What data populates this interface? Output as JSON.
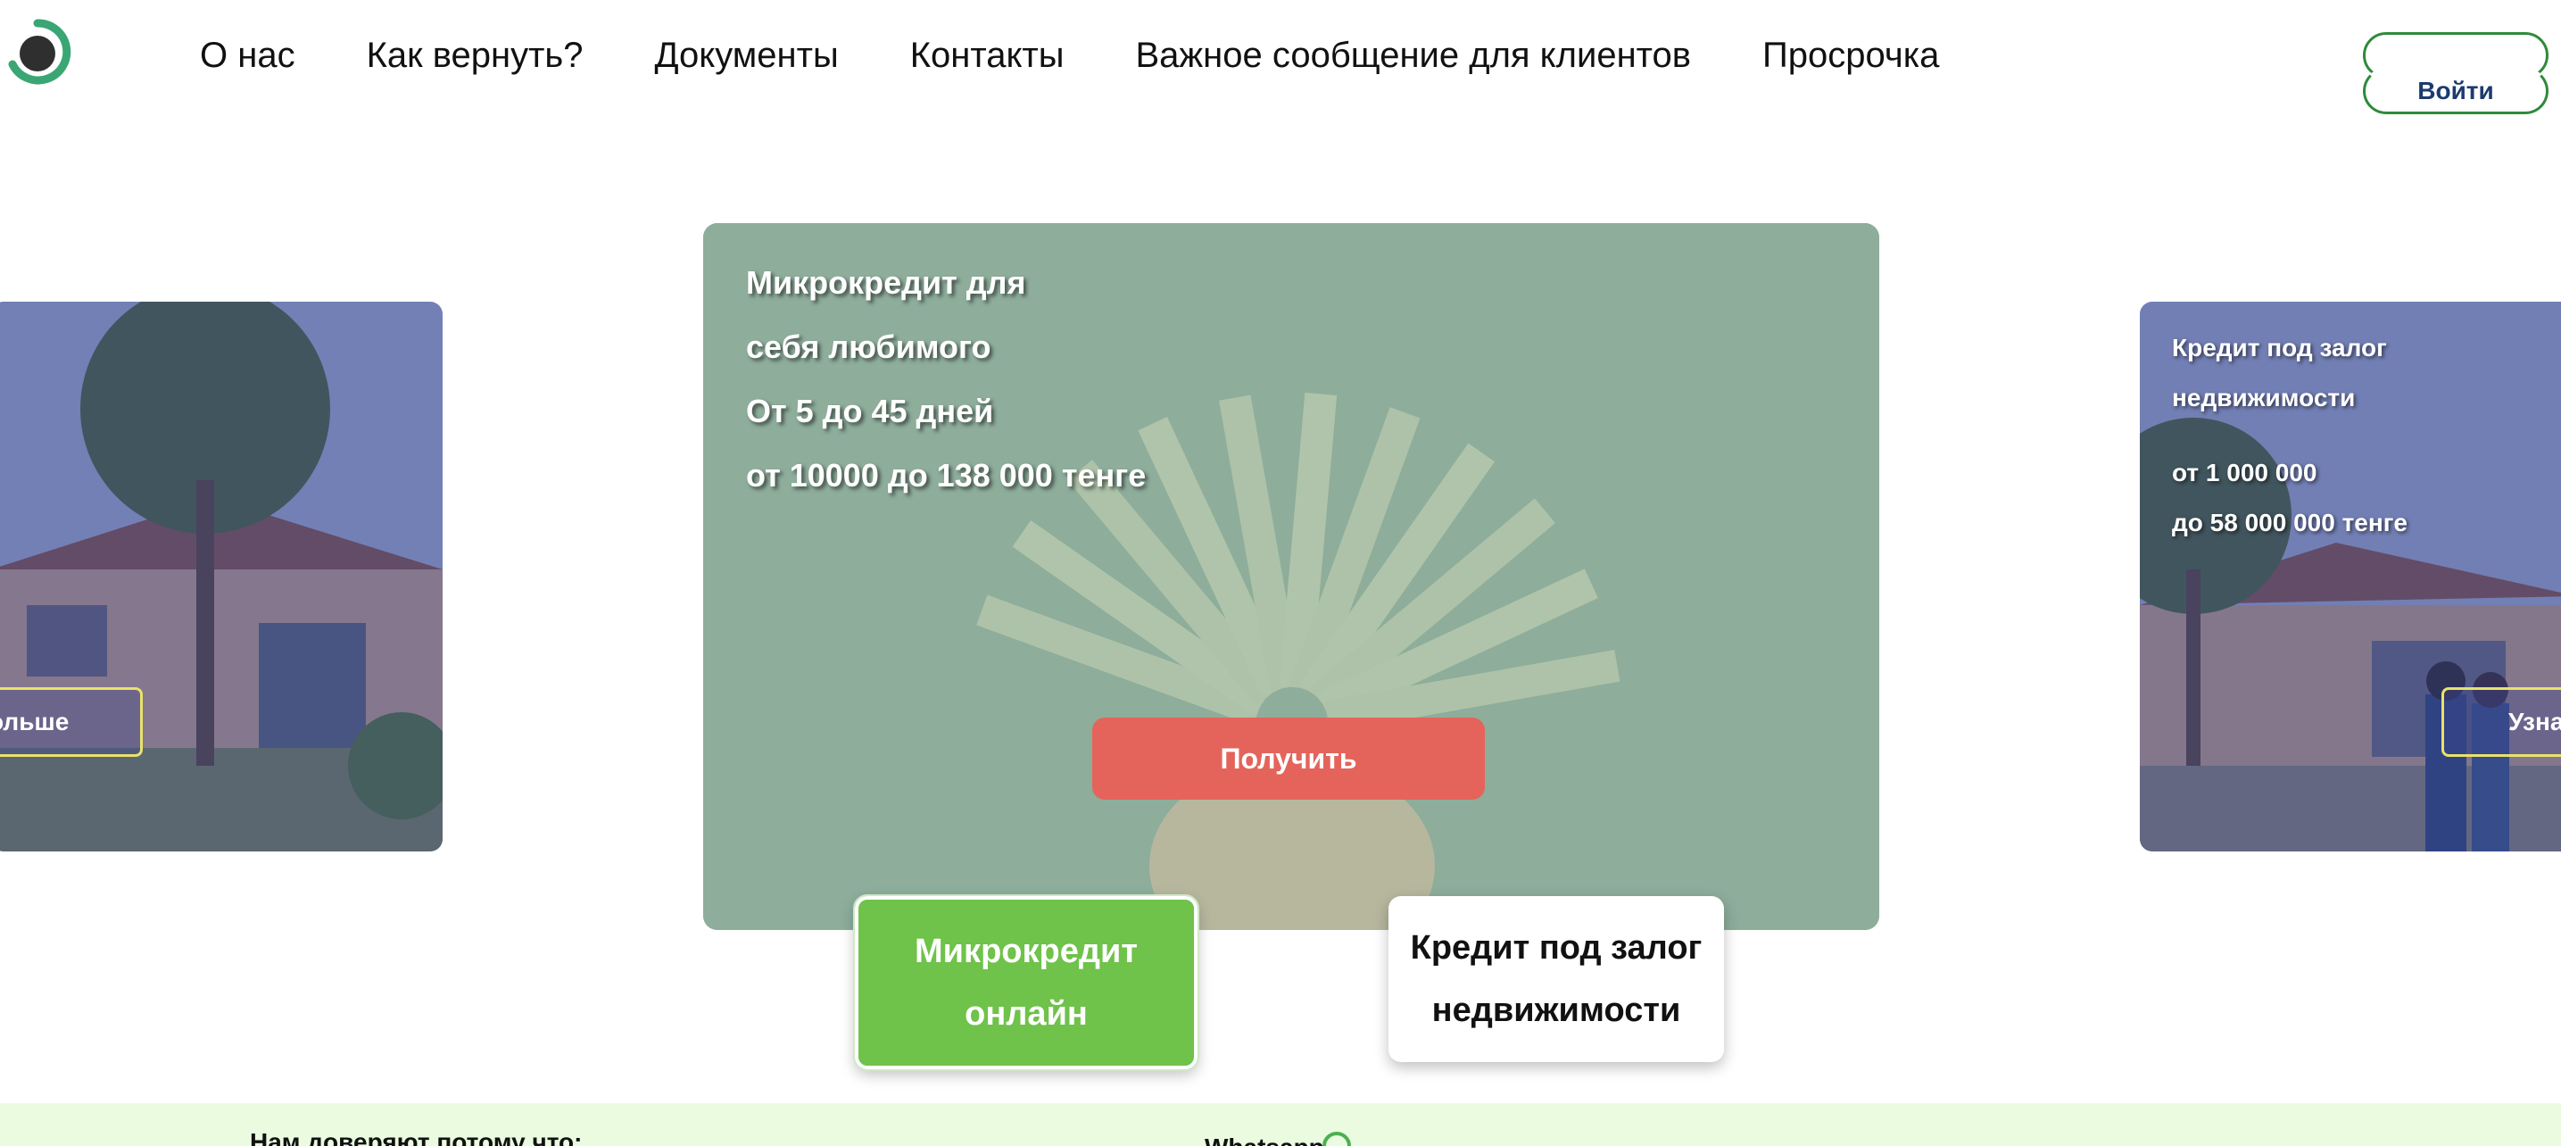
{
  "header": {
    "logo": "logo-circle",
    "nav": [
      "О нас",
      "Как вернуть?",
      "Документы",
      "Контакты",
      "Важное сообщение для клиентов",
      "Просрочка"
    ],
    "login_label": "Войти"
  },
  "carousel": {
    "left_card": {
      "button_label": "ольше"
    },
    "main_card": {
      "lines": [
        "Микрокредит для",
        "себя любимого",
        "От 5 до 45 дней",
        "от 10000 до 138 000 тенге"
      ],
      "button_label": "Получить"
    },
    "right_card": {
      "lines": [
        "Кредит под залог",
        "недвижимости",
        "от 1 000 000",
        "до 58 000 000 тенге"
      ],
      "button_label": "Узна"
    }
  },
  "tabs": [
    {
      "lines": [
        "Микрокредит",
        "онлайн"
      ],
      "active": true
    },
    {
      "lines": [
        "Кредит под залог",
        "недвижимости"
      ],
      "active": false
    }
  ],
  "footer_strip": {
    "trust_text": "Нам доверяют потому что:",
    "contact_text": "Whatsapp"
  },
  "colors": {
    "accent_green": "#6fc24a",
    "cta_red": "#e4645b",
    "login_border": "#2e8b3a",
    "strip_bg": "#eafbe0"
  }
}
